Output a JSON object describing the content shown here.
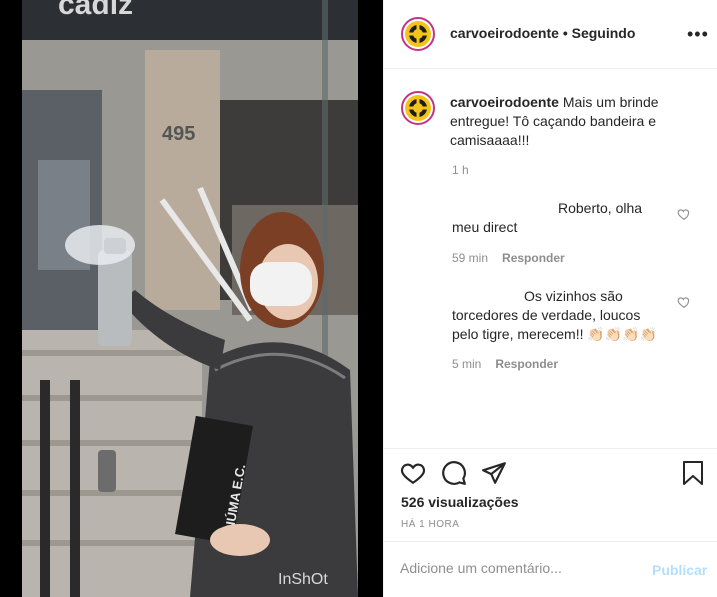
{
  "post": {
    "username": "carvoeirodoente",
    "separator": "•",
    "follow_status": "Seguindo",
    "more_label": "•••"
  },
  "caption": {
    "username": "carvoeirodoente",
    "text": "Mais um brinde entregue! Tô caçando bandeira e camisaaaa!!!",
    "time": "1 h"
  },
  "comments": [
    {
      "text": "Roberto, olha meu direct",
      "time": "59 min",
      "reply": "Responder"
    },
    {
      "text": "Os vizinhos são torcedores de verdade, loucos pelo tigre, merecem!! 👏🏻👏🏻👏🏻👏🏻",
      "time": "5 min",
      "reply": "Responder"
    }
  ],
  "stats": {
    "views": "526 visualizações",
    "time_ago": "HÁ 1 HORA"
  },
  "comment_box": {
    "placeholder": "Adicione um comentário...",
    "publish_label": "Publicar"
  },
  "video": {
    "building_text": "cadiz",
    "number": "495",
    "bottle_text": "CIÚMA E.C.",
    "watermark": "InShOt"
  },
  "colors": {
    "link_blue_disabled": "#b2dffc",
    "avatar_ring": "#c13584",
    "avatar_bg": "#f3c41a",
    "text_primary": "#262626",
    "text_secondary": "#8e8e8e"
  },
  "icons": [
    "heart-icon",
    "comment-icon",
    "share-icon",
    "bookmark-icon",
    "more-options-icon"
  ]
}
